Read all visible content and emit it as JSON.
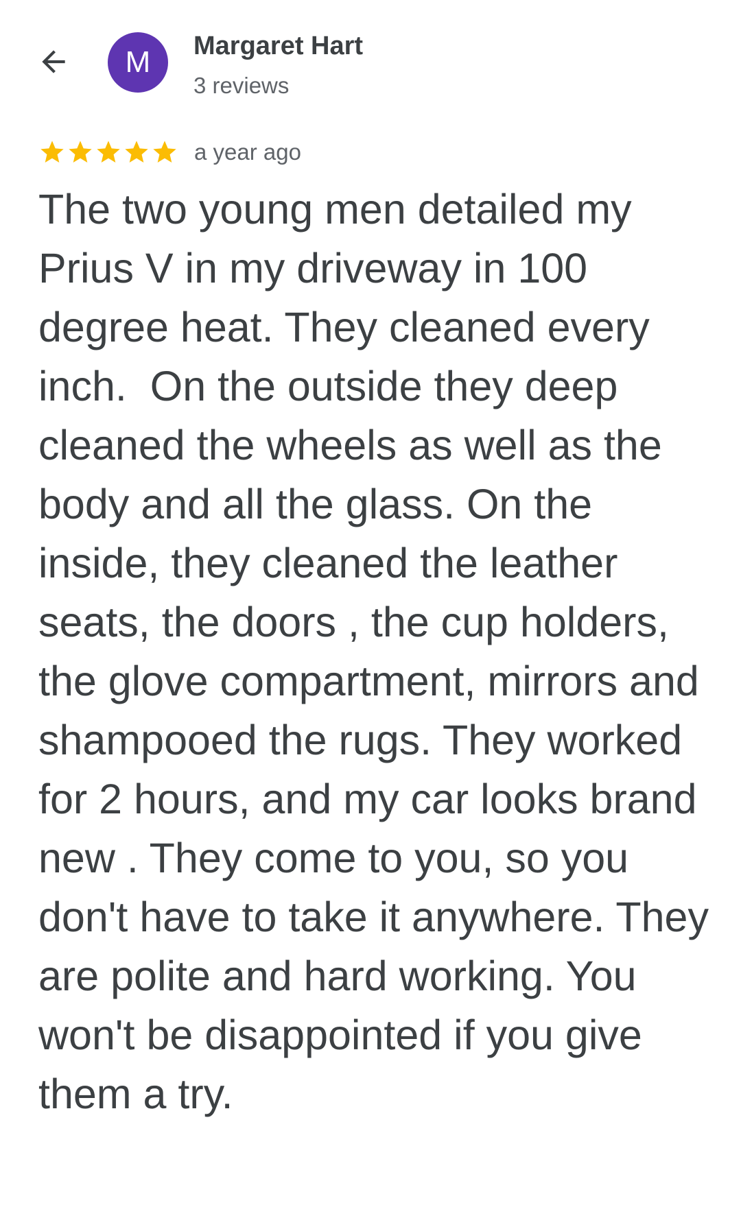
{
  "header": {
    "back_icon": "arrow-back-icon",
    "avatar_initial": "M",
    "avatar_color": "#5e35b1",
    "author_name": "Margaret Hart",
    "review_count": "3 reviews"
  },
  "review": {
    "rating": 5,
    "rating_max": 5,
    "star_color": "#fbbc04",
    "time": "a year ago",
    "text": "The two young men detailed my Prius V in my driveway in 100 degree heat. They cleaned every inch.  On the outside they deep cleaned the wheels as well as the body and all the glass. On the inside, they cleaned the leather seats, the doors , the cup holders, the glove compartment, mirrors and shampooed the rugs. They worked for 2 hours, and my car looks brand new . They come to you, so you don't have to take it anywhere. They are polite and hard working. You won't be disappointed if you give them a try."
  }
}
